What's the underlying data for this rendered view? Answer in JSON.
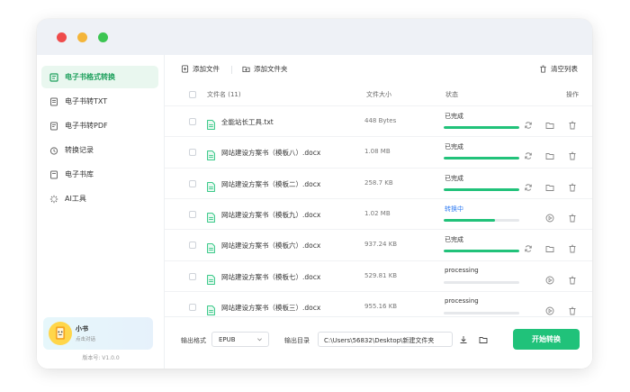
{
  "sidebar": {
    "items": [
      {
        "label": "电子书格式转换",
        "icon": "book-convert-icon",
        "active": true
      },
      {
        "label": "电子书转TXT",
        "icon": "txt-icon",
        "active": false
      },
      {
        "label": "电子书转PDF",
        "icon": "pdf-icon",
        "active": false
      },
      {
        "label": "转换记录",
        "icon": "clock-icon",
        "active": false
      },
      {
        "label": "电子书库",
        "icon": "library-icon",
        "active": false
      },
      {
        "label": "AI工具",
        "icon": "ai-sparkle-icon",
        "active": false
      }
    ],
    "user": {
      "name": "小书",
      "subtitle": "点击对话"
    },
    "version": "版本号: V1.0.0"
  },
  "toolbar": {
    "add_file": "添加文件",
    "add_folder": "添加文件夹",
    "clear_list": "清空列表"
  },
  "table": {
    "headers": {
      "name": "文件名 (11)",
      "size": "文件大小",
      "status": "状态",
      "action": "操作"
    },
    "rows": [
      {
        "name": "全能站长工具.txt",
        "size": "448 Bytes",
        "status": "已完成",
        "progress": 1.0,
        "done": true
      },
      {
        "name": "网站建设方案书（模板八）.docx",
        "size": "1.08 MB",
        "status": "已完成",
        "progress": 1.0,
        "done": true
      },
      {
        "name": "网站建设方案书（模板二）.docx",
        "size": "258.7 KB",
        "status": "已完成",
        "progress": 1.0,
        "done": true
      },
      {
        "name": "网站建设方案书（模板九）.docx",
        "size": "1.02 MB",
        "status": "转换中",
        "progress": 0.68,
        "done": false
      },
      {
        "name": "网站建设方案书（模板六）.docx",
        "size": "937.24 KB",
        "status": "已完成",
        "progress": 1.0,
        "done": true
      },
      {
        "name": "网站建设方案书（模板七）.docx",
        "size": "529.81 KB",
        "status": "processing",
        "progress": 0.0,
        "done": false
      },
      {
        "name": "网站建设方案书（模板三）.docx",
        "size": "955.16 KB",
        "status": "processing",
        "progress": 0.0,
        "done": false
      }
    ]
  },
  "footer": {
    "format_label": "输出格式",
    "format_value": "EPUB",
    "dir_label": "输出目录",
    "dir_value": "C:\\Users\\56832\\Desktop\\新建文件夹",
    "start_label": "开始转换"
  },
  "colors": {
    "accent": "#20c27a",
    "active_bg": "#e9f7ef",
    "active_text": "#1c9f5b",
    "converting": "#2f7bf2"
  }
}
